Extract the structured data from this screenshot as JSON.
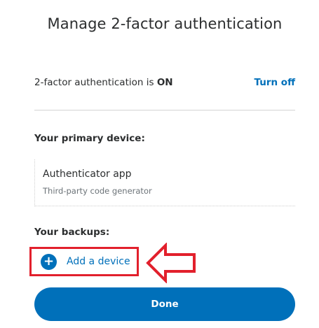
{
  "page": {
    "title": "Manage 2-factor authentication"
  },
  "status": {
    "prefix": "2-factor authentication is ",
    "state": "ON",
    "action_label": "Turn off"
  },
  "primary": {
    "label": "Your primary device:",
    "device_name": "Authenticator app",
    "device_desc": "Third-party code generator"
  },
  "backups": {
    "label": "Your backups:",
    "add_icon": "+",
    "add_label": "Add a device"
  },
  "footer": {
    "done_label": "Done"
  },
  "colors": {
    "accent": "#0070ba",
    "highlight": "#e2202c",
    "text": "#2c2e2f",
    "muted": "#6c7378"
  }
}
